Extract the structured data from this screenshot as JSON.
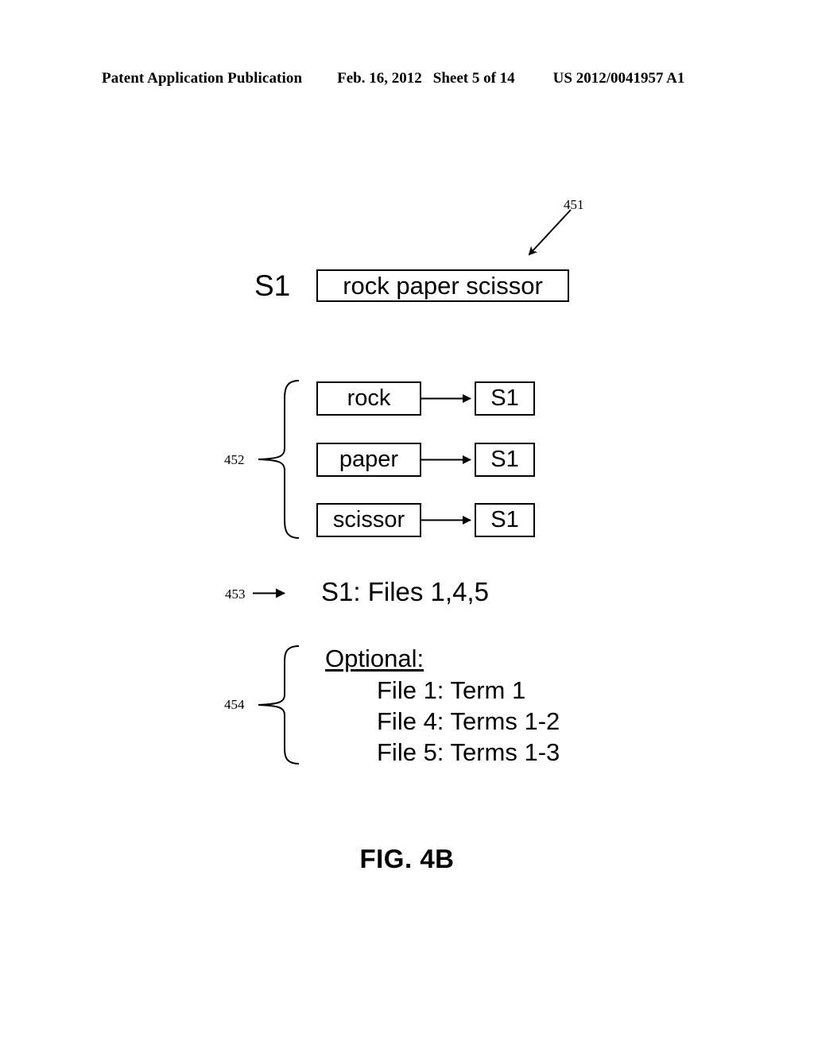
{
  "header": {
    "publication": "Patent Application Publication",
    "date": "Feb. 16, 2012",
    "sheet": "Sheet 5 of 14",
    "patent_number": "US 2012/0041957 A1"
  },
  "figure": {
    "caption": "FIG. 4B",
    "sentence": {
      "ref": "451",
      "label": "S1",
      "text": "rock paper scissor"
    },
    "terms": {
      "ref": "452",
      "rows": [
        {
          "term": "rock",
          "target": "S1"
        },
        {
          "term": "paper",
          "target": "S1"
        },
        {
          "term": "scissor",
          "target": "S1"
        }
      ]
    },
    "files": {
      "ref": "453",
      "text": "S1: Files 1,4,5"
    },
    "optional": {
      "ref": "454",
      "title": "Optional:",
      "items": [
        "File 1: Term 1",
        "File 4: Terms 1-2",
        "File 5: Terms 1-3"
      ]
    }
  },
  "colors": {
    "ink": "#000000",
    "page": "#ffffff"
  }
}
